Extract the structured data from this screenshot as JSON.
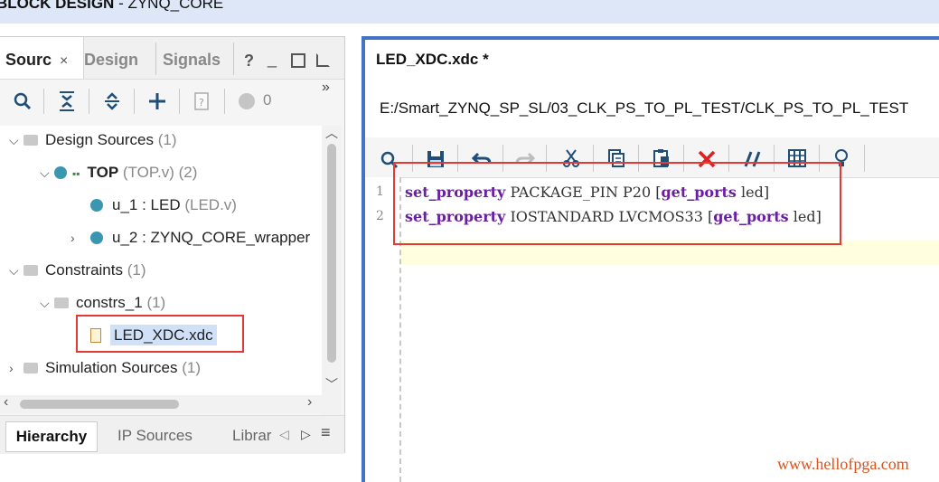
{
  "window": {
    "title_bold": "BLOCK DESIGN",
    "title_rest": " - ZYNQ_CORE"
  },
  "left_panel": {
    "tabs": [
      {
        "label": "Sourc",
        "active": true
      },
      {
        "label": "Design",
        "active": false
      },
      {
        "label": "Signals",
        "active": false
      }
    ],
    "tab_icons": [
      "close-icon",
      "help-icon",
      "minimize-icon",
      "restore-icon",
      "float-icon"
    ],
    "toolbar": {
      "icons": [
        "search-icon",
        "collapse-all-icon",
        "expand-all-icon",
        "add-icon",
        "properties-icon",
        "status-dot-icon"
      ],
      "count": "0",
      "overflow": "»"
    },
    "tree": {
      "design_sources": {
        "label": "Design Sources",
        "count": "(1)"
      },
      "top": {
        "label": "TOP",
        "detail": "(TOP.v) (2)"
      },
      "u1": {
        "label": "u_1 : LED",
        "detail": "(LED.v)"
      },
      "u2": {
        "label": "u_2 : ZYNQ_CORE_wrapper"
      },
      "constraints": {
        "label": "Constraints",
        "count": "(1)"
      },
      "constrs": {
        "label": "constrs_1",
        "count": "(1)"
      },
      "xdc": {
        "label": "LED_XDC.xdc"
      },
      "sim_sources": {
        "label": "Simulation Sources",
        "count": "(1)"
      }
    },
    "bottom_tabs": [
      {
        "label": "Hierarchy",
        "active": true
      },
      {
        "label": "IP Sources",
        "active": false
      },
      {
        "label": "Librar",
        "active": false
      }
    ]
  },
  "editor": {
    "title": "LED_XDC.xdc *",
    "path": "E:/Smart_ZYNQ_SP_SL/03_CLK_PS_TO_PL_TEST/CLK_PS_TO_PL_TEST",
    "toolbar_icons": [
      "search-icon",
      "save-icon",
      "undo-icon",
      "redo-icon",
      "cut-icon",
      "copy-icon",
      "paste-icon",
      "delete-icon",
      "comment-icon",
      "columns-icon",
      "hint-icon"
    ],
    "lines": [
      {
        "num": "1",
        "kw1": "set_property",
        "mid": " PACKAGE_PIN P20 [",
        "kw2": "get_ports",
        "end": " led]"
      },
      {
        "num": "2",
        "kw1": "set_property",
        "mid": " IOSTANDARD LVCMOS33 [",
        "kw2": "get_ports",
        "end": " led]"
      }
    ]
  },
  "watermark": "www.hellofpga.com",
  "colors": {
    "accent": "#4472c4",
    "highlight": "#e53935",
    "keyword": "#6a1fa0",
    "node_dot": "#3b96b0"
  }
}
